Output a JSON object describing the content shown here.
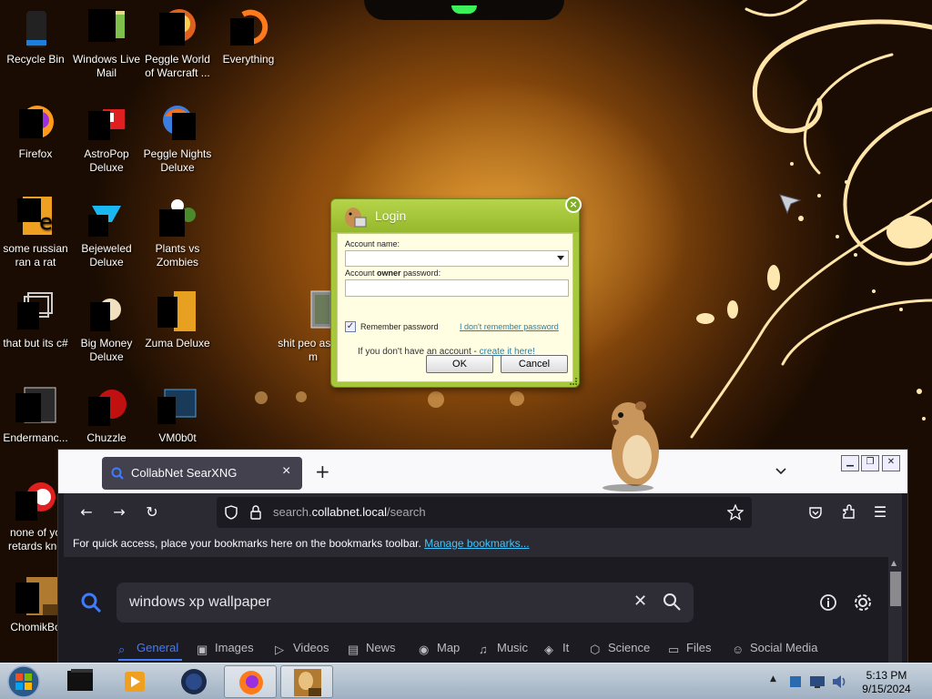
{
  "desktop": {
    "icons": [
      {
        "label": "Recycle Bin",
        "icon": "recycle-bin-icon"
      },
      {
        "label": "Windows Live Mail",
        "icon": "mail-icon"
      },
      {
        "label": "Peggle World of Warcraft ...",
        "icon": "peggle-icon"
      },
      {
        "label": "Everything",
        "icon": "everything-search-icon"
      },
      {
        "label": "Firefox",
        "icon": "firefox-icon"
      },
      {
        "label": "AstroPop Deluxe",
        "icon": "astropop-icon"
      },
      {
        "label": "Peggle Nights Deluxe",
        "icon": "peggle-nights-icon"
      },
      {
        "label": "some russian ran a rat",
        "icon": "file-icon"
      },
      {
        "label": "Bejeweled Deluxe",
        "icon": "bejeweled-icon"
      },
      {
        "label": "Plants vs Zombies",
        "icon": "pvz-icon"
      },
      {
        "label": "that but its c#",
        "icon": "folder-icon"
      },
      {
        "label": "Big Money Deluxe",
        "icon": "big-money-icon"
      },
      {
        "label": "Zuma Deluxe",
        "icon": "zuma-icon"
      },
      {
        "label": "Endermanc...",
        "icon": "app-icon"
      },
      {
        "label": "Chuzzle",
        "icon": "chuzzle-icon"
      },
      {
        "label": "VM0b0t",
        "icon": "vmobot-icon"
      },
      {
        "label": "none of yo retards kno",
        "icon": "file-icon"
      },
      {
        "label": "ChomikBo",
        "icon": "chomikbox-icon"
      },
      {
        "label": "shit peo asked m",
        "icon": "folder-icon"
      }
    ]
  },
  "login": {
    "title": "Login",
    "close_glyph": "×",
    "account_name_label": "Account name:",
    "password_label_pre": "Account ",
    "password_label_bold": "owner",
    "password_label_post": " password:",
    "remember_label": "Remember password",
    "remember_checked": true,
    "forgot_link": "I don't remember password",
    "no_account_text": "If you don't have an account - ",
    "create_link": "create it here!",
    "ok_label": "OK",
    "cancel_label": "Cancel"
  },
  "browser": {
    "tab_title": "CollabNet SearXNG",
    "tab_close": "×",
    "new_tab": "+",
    "url_prefix": "search.",
    "url_domain": "collabnet.local",
    "url_path": "/search",
    "bookmarks_text": "For quick access, place your bookmarks here on the bookmarks toolbar.",
    "bookmarks_link": "Manage bookmarks...",
    "search_query": "windows xp wallpaper",
    "categories": [
      {
        "label": "General",
        "icon": "search-icon",
        "active": true
      },
      {
        "label": "Images",
        "icon": "image-icon"
      },
      {
        "label": "Videos",
        "icon": "play-icon"
      },
      {
        "label": "News",
        "icon": "news-icon"
      },
      {
        "label": "Map",
        "icon": "map-pin-icon"
      },
      {
        "label": "Music",
        "icon": "music-icon"
      },
      {
        "label": "It",
        "icon": "layers-icon"
      },
      {
        "label": "Science",
        "icon": "science-icon"
      },
      {
        "label": "Files",
        "icon": "files-icon"
      },
      {
        "label": "Social Media",
        "icon": "people-icon"
      }
    ],
    "accent": "#3f7bff"
  },
  "taskbar": {
    "clock_time": "5:13 PM",
    "clock_date": "9/15/2024",
    "tray_arrow": "▲"
  }
}
